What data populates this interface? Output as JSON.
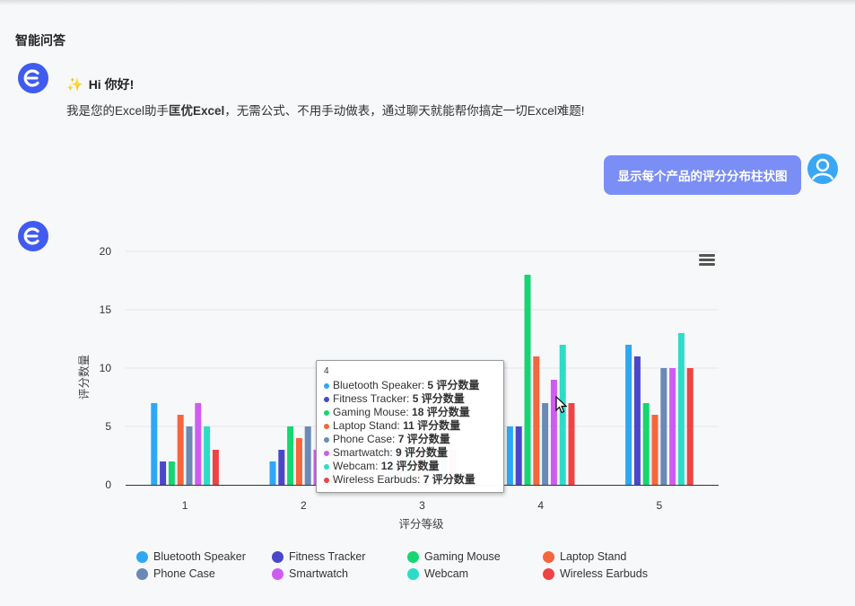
{
  "page": {
    "title": "智能问答"
  },
  "greeting": {
    "line1": "Hi 你好!",
    "line2_prefix": "我是您的Excel助手",
    "line2_brand": "匡优Excel",
    "line2_suffix": "，无需公式、不用手动做表，通过聊天就能帮你搞定一切Excel难题!"
  },
  "user_message": "显示每个产品的评分分布柱状图",
  "colors": {
    "Bluetooth Speaker": "#2ea7f5",
    "Fitness Tracker": "#4b47c9",
    "Gaming Mouse": "#15d672",
    "Laptop Stand": "#f5663c",
    "Phone Case": "#6a89b5",
    "Smartwatch": "#cf5cf0",
    "Webcam": "#2edbc7",
    "Wireless Earbuds": "#ee4444"
  },
  "chart_data": {
    "type": "bar",
    "title": "",
    "xlabel": "评分等级",
    "ylabel": "评分数量",
    "ylim": [
      0,
      20
    ],
    "yticks": [
      0,
      5,
      10,
      15,
      20
    ],
    "categories": [
      "1",
      "2",
      "3",
      "4",
      "5"
    ],
    "legend_position": "bottom",
    "series": [
      {
        "name": "Bluetooth Speaker",
        "values": [
          7,
          2,
          3,
          5,
          12
        ]
      },
      {
        "name": "Fitness Tracker",
        "values": [
          2,
          3,
          4,
          5,
          11
        ]
      },
      {
        "name": "Gaming Mouse",
        "values": [
          2,
          5,
          3,
          18,
          7
        ]
      },
      {
        "name": "Laptop Stand",
        "values": [
          6,
          4,
          3,
          11,
          6
        ]
      },
      {
        "name": "Phone Case",
        "values": [
          5,
          5,
          3,
          7,
          10
        ]
      },
      {
        "name": "Smartwatch",
        "values": [
          7,
          3,
          3,
          9,
          10
        ]
      },
      {
        "name": "Webcam",
        "values": [
          5,
          4,
          3,
          12,
          13
        ]
      },
      {
        "name": "Wireless Earbuds",
        "values": [
          3,
          3,
          3,
          7,
          10
        ]
      }
    ]
  },
  "tooltip": {
    "header": "4",
    "unit": "评分数量",
    "rows": [
      {
        "name": "Bluetooth Speaker",
        "value": "5"
      },
      {
        "name": "Fitness Tracker",
        "value": "5"
      },
      {
        "name": "Gaming Mouse",
        "value": "18"
      },
      {
        "name": "Laptop Stand",
        "value": "11"
      },
      {
        "name": "Phone Case",
        "value": "7"
      },
      {
        "name": "Smartwatch",
        "value": "9"
      },
      {
        "name": "Webcam",
        "value": "12"
      },
      {
        "name": "Wireless Earbuds",
        "value": "7"
      }
    ]
  },
  "icons": {
    "menu": "hamburger-menu-icon",
    "bot": "bot-avatar-icon",
    "user": "user-avatar-icon",
    "sparkle": "sparkle-icon"
  }
}
